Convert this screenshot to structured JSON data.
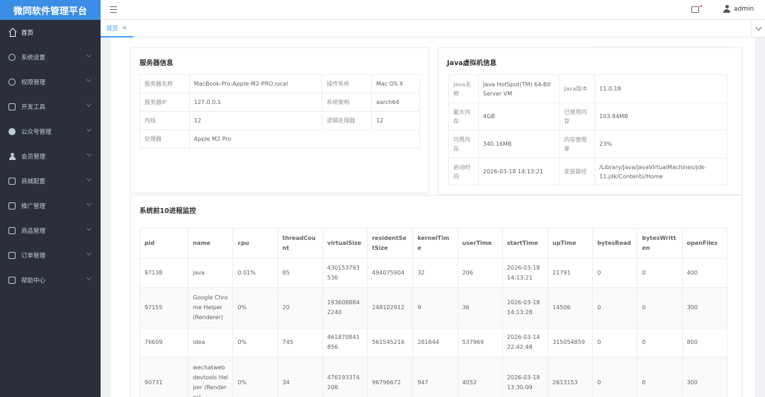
{
  "app": {
    "title": "微同软件管理平台"
  },
  "sidebar": {
    "items": [
      {
        "label": "首页",
        "icon": "home-icon"
      },
      {
        "label": "系统设置",
        "icon": "gear-icon"
      },
      {
        "label": "权限管理",
        "icon": "lock-icon"
      },
      {
        "label": "开发工具",
        "icon": "keyboard-icon"
      },
      {
        "label": "公众号管理",
        "icon": "chat-icon"
      },
      {
        "label": "会员管理",
        "icon": "user-icon"
      },
      {
        "label": "商城配置",
        "icon": "store-icon"
      },
      {
        "label": "推广管理",
        "icon": "promote-icon"
      },
      {
        "label": "商品管理",
        "icon": "product-icon"
      },
      {
        "label": "订单管理",
        "icon": "order-icon"
      },
      {
        "label": "帮助中心",
        "icon": "help-icon"
      }
    ]
  },
  "header": {
    "username": "admin"
  },
  "tabs": [
    {
      "label": "首页",
      "close": "×"
    }
  ],
  "server": {
    "title": "服务器信息",
    "rows": [
      [
        "服务器名称",
        "MacBook-Pro-Apple-M2-PRO.local",
        "操作系统",
        "Mac OS X"
      ],
      [
        "服务器IP",
        "127.0.0.1",
        "系统架构",
        "aarch64"
      ],
      [
        "内核",
        "12",
        "逻辑处理器",
        "12"
      ],
      [
        "处理器",
        "Apple M2 Pro",
        "",
        ""
      ]
    ]
  },
  "jvm": {
    "title": "Java虚拟机信息",
    "rows": [
      [
        "Java名称",
        "Java HotSpot(TM) 64-Bit Server VM",
        "Java版本",
        "11.0.18"
      ],
      [
        "最大内存",
        "4GB",
        "已使用内存",
        "103.84MB"
      ],
      [
        "可用内存",
        "340.16MB",
        "内存使用率",
        "23%"
      ],
      [
        "启动时间",
        "2026-03-18 14:13:21",
        "安装路径",
        "/Library/Java/JavaVirtualMachines/jdk-11.jdk/Contents/Home"
      ]
    ]
  },
  "processes": {
    "title": "系统前10进程监控",
    "columns": [
      "pid",
      "name",
      "cpu",
      "threadCount",
      "virtualSize",
      "residentSetSize",
      "kernelTime",
      "userTime",
      "startTime",
      "upTime",
      "bytesRead",
      "bytesWritten",
      "openFiles"
    ],
    "rows": [
      [
        "97138",
        "java",
        "0.01%",
        "85",
        "430153793536",
        "494075904",
        "32",
        "206",
        "2026-03-18 14:13:21",
        "21791",
        "0",
        "0",
        "400"
      ],
      [
        "97155",
        "Google Chrome Helper (Renderer)",
        "0%",
        "20",
        "1936088842240",
        "248102912",
        "9",
        "36",
        "2026-03-18 14:13:28",
        "14506",
        "0",
        "0",
        "300"
      ],
      [
        "76609",
        "idea",
        "0%",
        "745",
        "461870841856",
        "561545216",
        "281644",
        "537969",
        "2026-03-14 22:42:48",
        "315054859",
        "0",
        "0",
        "800"
      ],
      [
        "90731",
        "wechatwebdevtools Helper (Renderer)",
        "0%",
        "34",
        "476193374208",
        "96796672",
        "947",
        "4052",
        "2026-03-18 13:30:09",
        "2613153",
        "0",
        "0",
        "300"
      ]
    ]
  }
}
